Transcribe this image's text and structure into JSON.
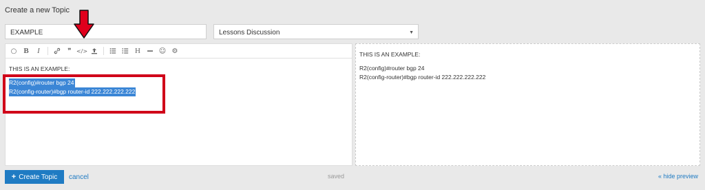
{
  "header": {
    "title": "Create a new Topic"
  },
  "form": {
    "title_value": "EXAMPLE",
    "category_value": "Lessons Discussion"
  },
  "toolbar": {
    "buttons": [
      {
        "name": "quote-icon",
        "glyph": "○"
      },
      {
        "name": "bold-icon",
        "glyph": "B"
      },
      {
        "name": "italic-icon",
        "glyph": "I"
      },
      {
        "name": "link-icon",
        "glyph": "🔗"
      },
      {
        "name": "blockquote-icon",
        "glyph": "❞"
      },
      {
        "name": "code-icon",
        "glyph": "</>"
      },
      {
        "name": "upload-icon",
        "glyph": "⭱"
      },
      {
        "name": "bullet-list-icon",
        "glyph": "☰"
      },
      {
        "name": "numbered-list-icon",
        "glyph": "☷"
      },
      {
        "name": "heading-icon",
        "glyph": "H"
      },
      {
        "name": "horizontal-rule-icon",
        "glyph": "—"
      },
      {
        "name": "emoji-icon",
        "glyph": "☺"
      },
      {
        "name": "options-gear-icon",
        "glyph": "⚙"
      }
    ]
  },
  "editor": {
    "line1": "THIS IS AN EXAMPLE:",
    "line2": "R2(config)#router bgp 24",
    "line3": "R2(config-router)#bgp router-id 222.222.222.222"
  },
  "preview": {
    "line1": "THIS IS AN EXAMPLE:",
    "line2": "R2(config)#router bgp 24",
    "line3": "R2(config-router)#bgp router-id 222.222.222.222"
  },
  "footer": {
    "create_label": "Create Topic",
    "cancel_label": "cancel",
    "saved_label": "saved",
    "hide_preview_label": "« hide preview"
  },
  "colors": {
    "accent": "#1f7bc3",
    "highlight": "#3b86d6",
    "annotation_red": "#d00019"
  }
}
